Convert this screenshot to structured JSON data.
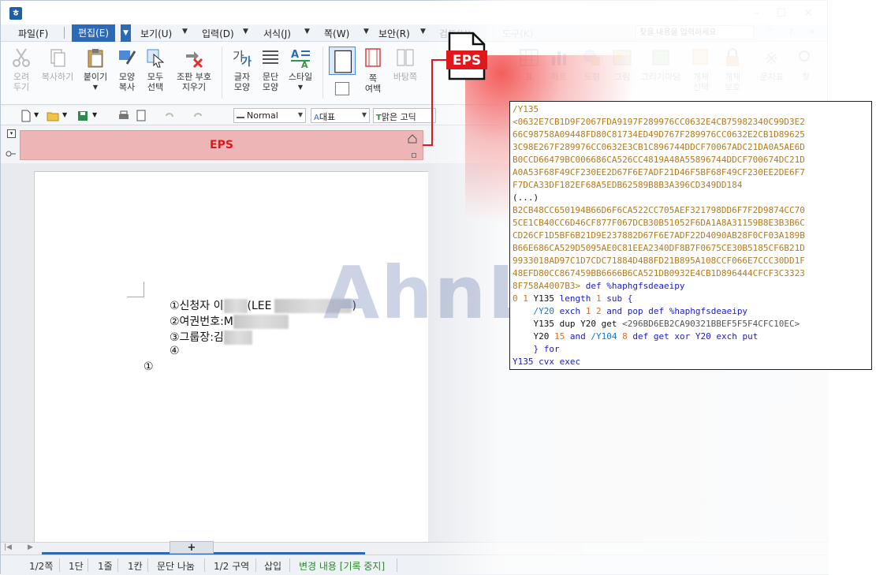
{
  "app": {
    "menu": [
      "파일(F)",
      "편집(E)",
      "보기(U)",
      "입력(D)",
      "서식(J)",
      "쪽(W)",
      "보안(R)",
      "검토(H)",
      "도구(K)"
    ],
    "search_placeholder": "찾을 내용을 입력하세요"
  },
  "ribbon": {
    "cut": "오려\n두기",
    "copy": "복사하기",
    "paste": "붙이기",
    "format_copy": "모양\n복사",
    "select_all": "모두\n선택",
    "clear_protect": "조판 부호\n지우기",
    "char_shape": "글자\n모양",
    "para_shape": "문단\n모양",
    "style": "스타일",
    "page_margin": "쪽\n여백",
    "background": "바탕쪽",
    "more": [
      "표",
      "차트",
      "도형",
      "그림",
      "그리기마당",
      "개체\n선택",
      "개체\n보호",
      "문자표",
      "찾"
    ]
  },
  "toolbar": {
    "style_combo": "Normal",
    "font_kind": "대표",
    "font_name": "맑은 고딕"
  },
  "memo": {
    "label": "EPS"
  },
  "document": {
    "lines": [
      "①신청자 이",
      "(LEE",
      ")",
      "②여권번호:M",
      "③그룹장:김",
      "④",
      "①"
    ]
  },
  "status": {
    "page": "1/2쪽",
    "column": "1단",
    "line": "1줄",
    "cell": "1칸",
    "para_split": "문단 나눔",
    "section": "1/2 구역",
    "insert": "삽입",
    "track": "변경 내용 [기록 중지]"
  },
  "overlay": {
    "eps_label": "EPS",
    "watermark": "AhnLab"
  },
  "code": {
    "lines": [
      "/Y135",
      "<0632E7CB1D9F2067FDA9197F289976CC0632E4CB75982340C99D3E2",
      "66C98758A09448FD80C81734ED49D767F289976CC0632E2CB1D89625",
      "3C98E267F289976CC0632E3CB1C896744DDCF70067ADC21DA0A5AE6D",
      "B0CCD66479BC006686CA526CC4819A48A55896744DDCF700674DC21D",
      "A0A53F68F49CF230EE2D67F6E7ADF21D46F5BF68F49CF230EE2DE6F7",
      "F7DCA33DF182EF68A5EDB62589B8B3A396CD349DD184",
      "(...)",
      "B2CB48CC650194B66D6F6CA522CC705AEF321798DD6F7F2D9874CC70",
      "5CE1CB40CC6D46CF877F067DCB30B51052F6DA1A8A31159B8E3B3B6C",
      "CD26CF1D5BF6B21D9E237882D67F6E7ADF22D4090AB28F0CF03A189B",
      "B66E686CA529D5095AE0C81EEA2340DF8B7F0675CE30B5185CF6B21D",
      "9933018AD97C1D7CDC71884D4B8FD21B895A108CCF066E7CCC30DD1F",
      "48EFD80CC867459BB6666B6CA521DB0932E4CB1D896444CFCF3C3323",
      "8F758A4007B3>",
      " def %haphgfsdeaeipy",
      "0 1",
      "Y135",
      "length",
      "1",
      "sub {",
      "/Y20",
      "exch",
      "1 2",
      "and pop def %haphgfsdeaeipy",
      "Y135 dup Y20 get",
      "<296BD6EB2CA90321BBEF5F5F4CFC10EC>",
      "Y20",
      "15",
      "and",
      "/Y104",
      "8",
      "def get xor Y20 exch put",
      "} for",
      "Y135 cvx exec"
    ]
  },
  "colors": {
    "accent": "#2c69b6",
    "eps_red": "#e0181c",
    "memo_pink": "#edb5b6"
  }
}
